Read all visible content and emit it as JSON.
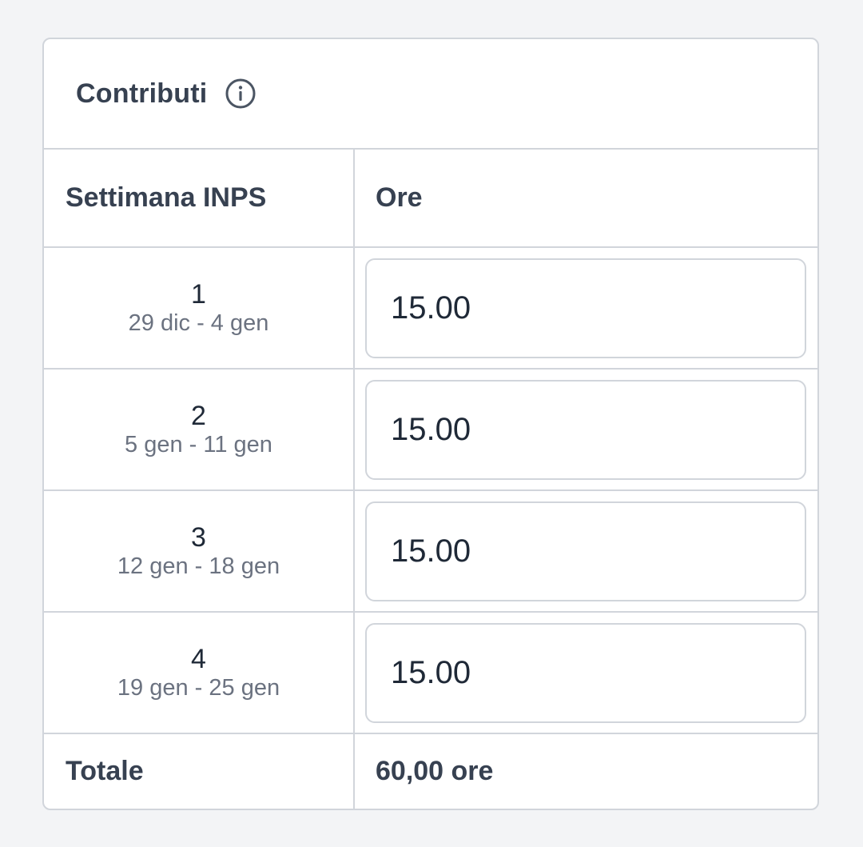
{
  "card": {
    "title": "Contributi",
    "info_icon": "info-circle-icon"
  },
  "table": {
    "headers": {
      "week": "Settimana INPS",
      "hours": "Ore"
    },
    "rows": [
      {
        "week": "1",
        "range": "29 dic - 4 gen",
        "hours": "15.00"
      },
      {
        "week": "2",
        "range": "5 gen - 11 gen",
        "hours": "15.00"
      },
      {
        "week": "3",
        "range": "12 gen - 18 gen",
        "hours": "15.00"
      },
      {
        "week": "4",
        "range": "19 gen - 25 gen",
        "hours": "15.00"
      }
    ],
    "total": {
      "label": "Totale",
      "value": "60,00 ore"
    }
  },
  "colors": {
    "border": "#d1d5db",
    "text": "#374151",
    "muted": "#6b7280",
    "background": "#f3f4f6"
  }
}
